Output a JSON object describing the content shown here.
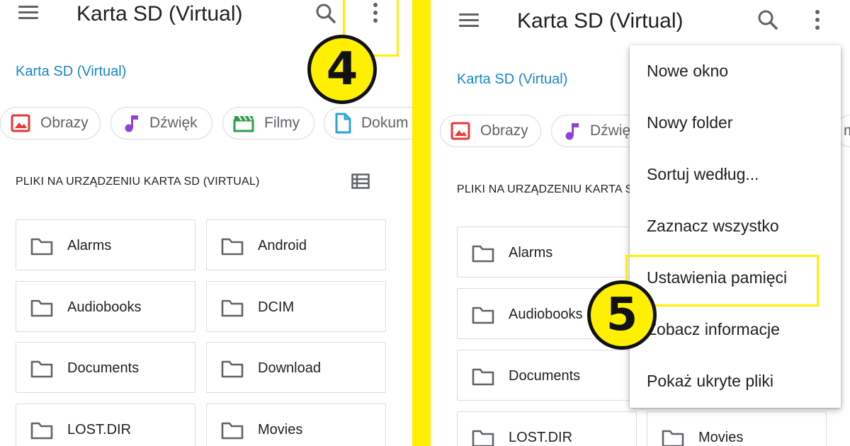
{
  "left": {
    "title": "Karta SD (Virtual)",
    "breadcrumb": "Karta SD (Virtual)",
    "chips": [
      {
        "label": "Obrazy",
        "icon": "image-icon",
        "color": "#e53935"
      },
      {
        "label": "Dźwięk",
        "icon": "music-note-icon",
        "color": "#8e44d8"
      },
      {
        "label": "Filmy",
        "icon": "movie-icon",
        "color": "#2e9e4a"
      },
      {
        "label": "Dokum",
        "icon": "document-icon",
        "color": "#26a6d9"
      }
    ],
    "section_title": "PLIKI NA URZĄDZENIU KARTA SD (VIRTUAL)",
    "folders": [
      "Alarms",
      "Android",
      "Audiobooks",
      "DCIM",
      "Documents",
      "Download",
      "LOST.DIR",
      "Movies"
    ],
    "step_badge": "4"
  },
  "right": {
    "title": "Karta SD (Virtual)",
    "breadcrumb": "Karta SD (Virtual)",
    "chips": [
      {
        "label": "Obrazy",
        "icon": "image-icon",
        "color": "#e53935"
      },
      {
        "label": "Dźwię",
        "icon": "music-note-icon",
        "color": "#8e44d8"
      },
      {
        "label": "m",
        "icon": "",
        "color": ""
      }
    ],
    "section_title": "PLIKI NA URZĄDZENIU KARTA S",
    "folders": [
      "Alarms",
      "Audiobooks",
      "Documents",
      "LOST.DIR",
      "Movies"
    ],
    "menu": {
      "items": [
        "Nowe okno",
        "Nowy folder",
        "Sortuj według...",
        "Zaznacz wszystko",
        "Ustawienia pamięci",
        "Zobacz informacje",
        "Pokaż ukryte pliki"
      ],
      "highlighted_index": 4
    },
    "step_badge": "5"
  },
  "colors": {
    "highlight": "#ffef00",
    "link": "#1a86c8",
    "icon_gray": "#5f6368"
  }
}
